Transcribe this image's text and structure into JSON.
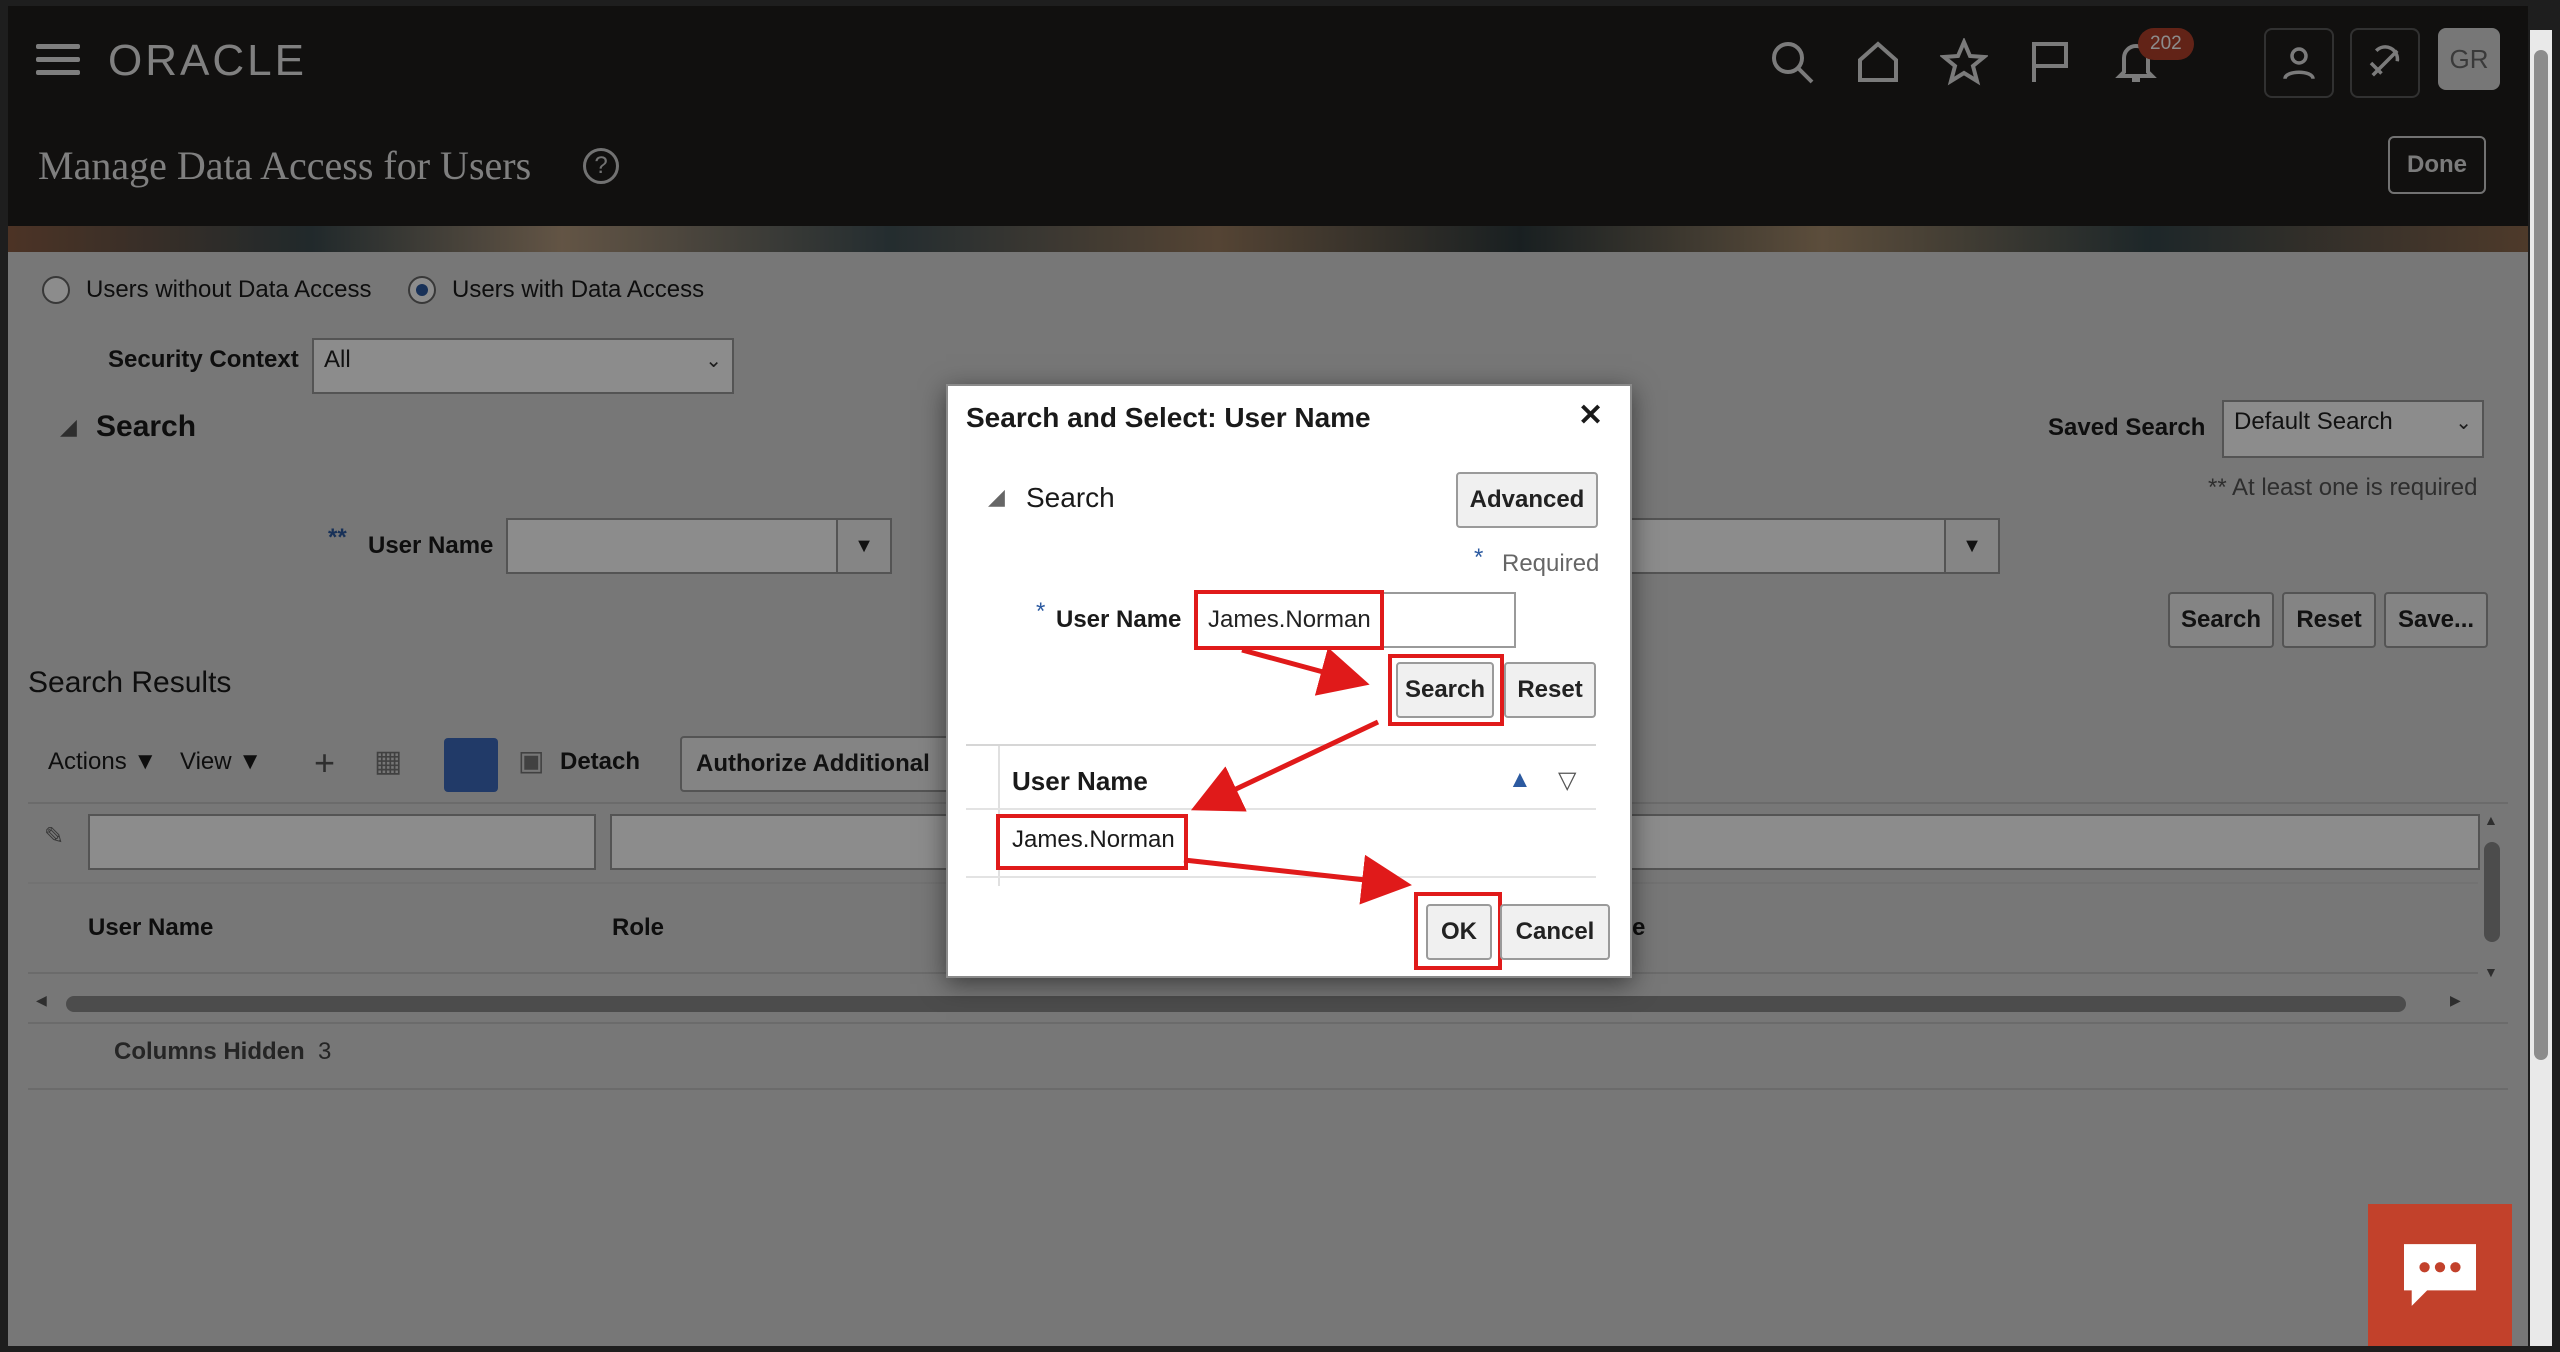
{
  "header": {
    "logo": "ORACLE",
    "page_title": "Manage Data Access for Users",
    "help_glyph": "?",
    "done_label": "Done",
    "notifications_count": "202",
    "avatar_initials": "GR"
  },
  "filters": {
    "radio_without": "Users without Data Access",
    "radio_with": "Users with Data Access",
    "security_context_label": "Security Context",
    "security_context_value": "All",
    "search_heading": "Search",
    "saved_search_label": "Saved Search",
    "saved_search_value": "Default Search",
    "at_least_one": "** At least one is required",
    "user_name_marker": "**",
    "user_name_label": "User Name",
    "search_btn": "Search",
    "reset_btn": "Reset",
    "save_btn": "Save..."
  },
  "results": {
    "heading": "Search Results",
    "actions_label": "Actions",
    "view_label": "View",
    "detach_label": "Detach",
    "authorize_label": "Authorize Additional",
    "col_user_name": "User Name",
    "col_role": "Role",
    "col_partial": "e",
    "columns_hidden_label": "Columns Hidden",
    "columns_hidden_count": "3"
  },
  "dialog": {
    "title": "Search and Select: User Name",
    "close_glyph": "✕",
    "search_label": "Search",
    "advanced_btn": "Advanced",
    "required_star": "*",
    "required_label": "Required",
    "user_name_star": "*",
    "user_name_label": "User Name",
    "user_name_value": "James.Norman",
    "search_btn": "Search",
    "reset_btn": "Reset",
    "col_user_name": "User Name",
    "result_row": "James.Norman",
    "ok_btn": "OK",
    "cancel_btn": "Cancel"
  },
  "colors": {
    "header_bg": "#201e1c",
    "annotation_red": "#e01a1a",
    "chat_widget": "#c2412b",
    "selected_radio": "#2c5aa0"
  }
}
